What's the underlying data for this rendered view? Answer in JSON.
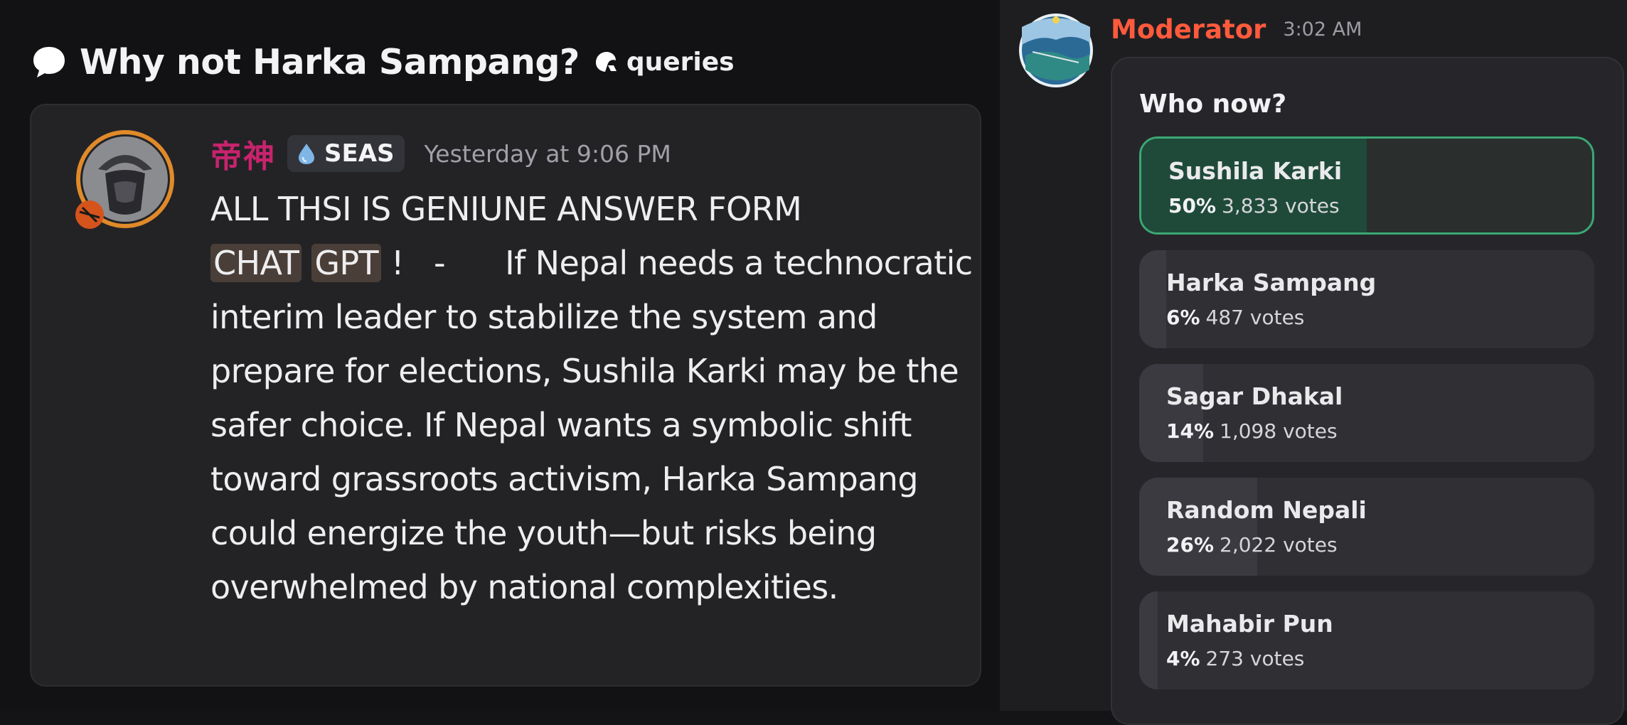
{
  "thread": {
    "title": "Why not Harka Sampang?",
    "tag": "queries",
    "icons": {
      "bubble": "speech-bubble-icon",
      "tag": "tag-icon"
    }
  },
  "message": {
    "username": "帝神",
    "guild_tag": "SEAS",
    "timestamp": "Yesterday at 9:06 PM",
    "text_parts": {
      "lead": "ALL THSI IS GENIUNE ANSWER FORM",
      "hl1": "CHAT",
      "hl2": "GPT",
      "after": " !   -      If Nepal needs a technocratic interim leader to stabilize the system and prepare for elections, Sushila Karki may be the safer choice. If Nepal wants a symbolic shift toward grassroots activism, Harka Sampang could energize the youth—but risks being overwhelmed by national complexities."
    },
    "colors": {
      "username": "#c8236d",
      "highlight": "#4a3f38"
    }
  },
  "poll_post": {
    "author": "Moderator",
    "time": "3:02 AM",
    "colors": {
      "author": "#ff5a3c",
      "selected_border": "#3aa874"
    },
    "poll": {
      "question": "Who now?",
      "options": [
        {
          "name": "Sushila Karki",
          "pct": "50%",
          "votes": "3,833 votes",
          "fraction": 0.5,
          "selected": true
        },
        {
          "name": "Harka Sampang",
          "pct": "6%",
          "votes": "487 votes",
          "fraction": 0.06,
          "selected": false
        },
        {
          "name": "Sagar Dhakal",
          "pct": "14%",
          "votes": "1,098 votes",
          "fraction": 0.14,
          "selected": false
        },
        {
          "name": "Random Nepali",
          "pct": "26%",
          "votes": "2,022 votes",
          "fraction": 0.26,
          "selected": false
        },
        {
          "name": "Mahabir Pun",
          "pct": "4%",
          "votes": "273 votes",
          "fraction": 0.04,
          "selected": false
        }
      ]
    }
  }
}
